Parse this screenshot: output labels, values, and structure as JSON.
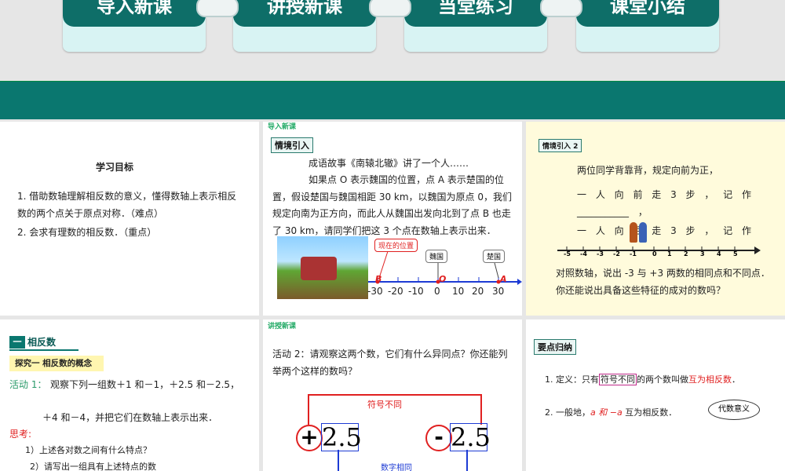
{
  "nav_tabs": [
    {
      "label": "导入新课"
    },
    {
      "label": "讲授新课"
    },
    {
      "label": "当堂练习"
    },
    {
      "label": "课堂小结"
    }
  ],
  "slide1": {
    "title": "学习目标",
    "item1": "1. 借助数轴理解相反数的意义，懂得数轴上表示相反数的两个点关于原点对称．（难点）",
    "item2": "2. 会求有理数的相反数．（重点）"
  },
  "slide2": {
    "section": "导入新课",
    "tag": "情境引入",
    "para1": "成语故事《南辕北辙》讲了一个人……",
    "para2": "如果点 O 表示魏国的位置，点 A 表示楚国的位置，假设楚国与魏国相距 30 km，以魏国为原点 0，我们规定向南为正方向，而此人从魏国出发向北到了点 B 也走了 30 km，请同学们把这 3 个点在数轴上表示出来．",
    "callout_current": "现在的位置",
    "callout_wei": "魏国",
    "callout_chu": "楚国",
    "point_b": "B",
    "point_o": "O",
    "point_a": "A",
    "ticks": [
      "-30",
      "-20",
      "-10",
      "0",
      "10",
      "20",
      "30"
    ]
  },
  "slide3": {
    "tag": "情境引入 2",
    "para1": "两位同学背靠背，规定向前为正，",
    "line1": "一 人 向 前 走 3 步 ， 记 作 ___________ ，",
    "line2": "一 人 向 后 走 3 步 ， 记 作",
    "ticks": [
      "-5",
      "-4",
      "-3",
      "-2",
      "-1",
      "0",
      "1",
      "2",
      "3",
      "4",
      "5"
    ],
    "para2": "对照数轴，说出 -3 与 +3 两数的相同点和不同点．你还能说出具备这些特征的成对的数吗？"
  },
  "slide4": {
    "section_num": "一",
    "section_title": "相反数",
    "explore": "探究一 相反数的概念",
    "activity_label": "活动 1：",
    "activity_text": "观察下列一组数＋1 和－1，＋2.5 和－2.5，",
    "activity_text2": "＋4 和－4，并把它们在数轴上表示出来．",
    "think": "思考:",
    "q1": "1）上述各对数之间有什么特点？",
    "q2": "2）请写出一组具有上述特点的数"
  },
  "slide5": {
    "section": "讲授新课",
    "activity": "活动 2：请观察这两个数，它们有什么异同点？你还能列举两个这样的数吗？",
    "sign_diff": "符号不同",
    "sign_plus": "+",
    "sign_minus": "-",
    "num_left": "2.5",
    "num_right": "2.5",
    "abs_same": "数字相同"
  },
  "slide6": {
    "tag": "要点归纳",
    "def_prefix": "1. 定义：只有",
    "def_box": "符号不同",
    "def_mid": "的两个数叫做",
    "def_red": "互为相反数",
    "def_end": "．",
    "gen_prefix": "2. 一般地，",
    "gen_red": "a 和 −a",
    "gen_end": " 互为相反数．",
    "bubble": "代数意义"
  },
  "colors": {
    "teal_dark": "#0e6e68",
    "teal_light": "#d8f3f3",
    "yellow_bg": "#fffbdc",
    "red": "#e02020",
    "blue_line": "#1d3bd4"
  }
}
